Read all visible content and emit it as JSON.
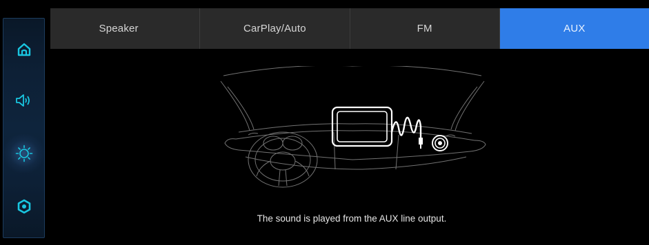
{
  "sidebar": {
    "items": [
      {
        "name": "home",
        "icon": "home-icon"
      },
      {
        "name": "sound",
        "icon": "speaker-icon"
      },
      {
        "name": "brightness",
        "icon": "sun-icon"
      },
      {
        "name": "settings",
        "icon": "settings-icon"
      }
    ],
    "accent_color": "#19c6e0"
  },
  "tabs": [
    {
      "label": "Speaker",
      "active": false
    },
    {
      "label": "CarPlay/Auto",
      "active": false
    },
    {
      "label": "FM",
      "active": false
    },
    {
      "label": "AUX",
      "active": true
    }
  ],
  "colors": {
    "tab_bg": "#2a2a2a",
    "tab_active": "#2f7de8"
  },
  "main": {
    "caption": "The sound is played from the AUX line output."
  }
}
